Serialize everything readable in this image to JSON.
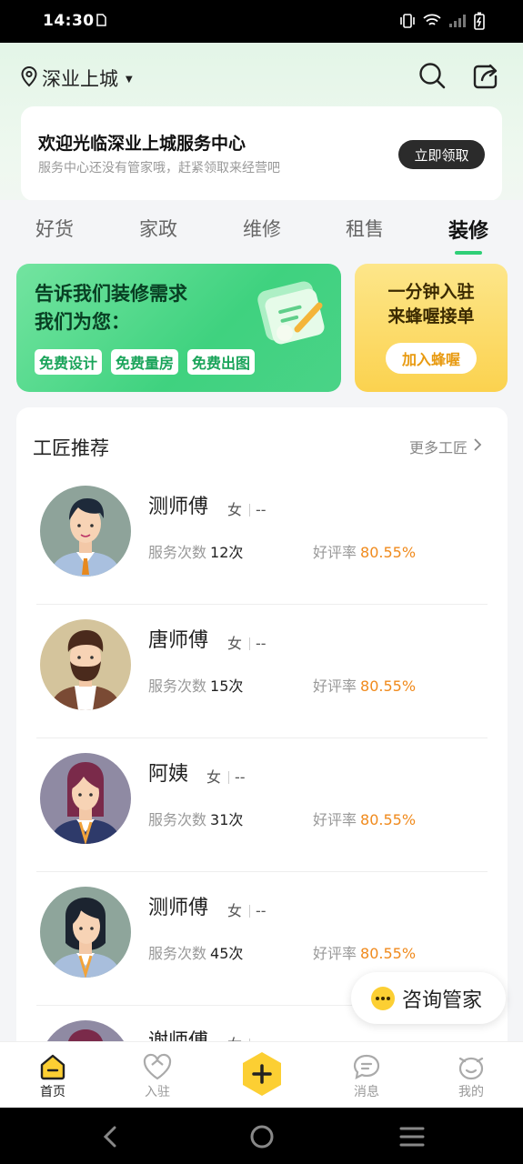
{
  "status_bar": {
    "time": "14:30"
  },
  "header": {
    "location": "深业上城"
  },
  "notice": {
    "title": "欢迎光临深业上城服务中心",
    "subtitle": "服务中心还没有管家哦，赶紧领取来经营吧",
    "button": "立即领取"
  },
  "tabs": [
    {
      "label": "好货"
    },
    {
      "label": "家政"
    },
    {
      "label": "维修"
    },
    {
      "label": "租售"
    },
    {
      "label": "装修"
    }
  ],
  "active_tab": "装修",
  "banner_left": {
    "line1": "告诉我们装修需求",
    "line2": "我们为您：",
    "chips": [
      "免费设计",
      "免费量房",
      "免费出图"
    ]
  },
  "banner_right": {
    "line1": "一分钟入驻",
    "line2": "来蜂喔接单",
    "button": "加入蜂喔"
  },
  "craftsmen_section": {
    "title": "工匠推荐",
    "more": "更多工匠",
    "service_label": "服务次数",
    "rating_label": "好评率",
    "items": [
      {
        "name": "测师傅",
        "gender": "女",
        "extra": "--",
        "services": "12次",
        "rating": "80.55%"
      },
      {
        "name": "唐师傅",
        "gender": "女",
        "extra": "--",
        "services": "15次",
        "rating": "80.55%"
      },
      {
        "name": "阿姨",
        "gender": "女",
        "extra": "--",
        "services": "31次",
        "rating": "80.55%"
      },
      {
        "name": "测师傅",
        "gender": "女",
        "extra": "--",
        "services": "45次",
        "rating": "80.55%"
      },
      {
        "name": "谢师傅",
        "gender": "女",
        "extra": "--",
        "services": "",
        "rating": ""
      }
    ]
  },
  "consult_button": "咨询管家",
  "bottom_nav": [
    {
      "label": "首页",
      "icon": "home-icon"
    },
    {
      "label": "入驻",
      "icon": "join-icon"
    },
    {
      "label": "",
      "icon": "plus-icon"
    },
    {
      "label": "消息",
      "icon": "message-icon"
    },
    {
      "label": "我的",
      "icon": "profile-icon"
    }
  ],
  "colors": {
    "accent_green": "#2fcf77",
    "rating_orange": "#f08a1c",
    "nav_yellow": "#fccf33"
  }
}
